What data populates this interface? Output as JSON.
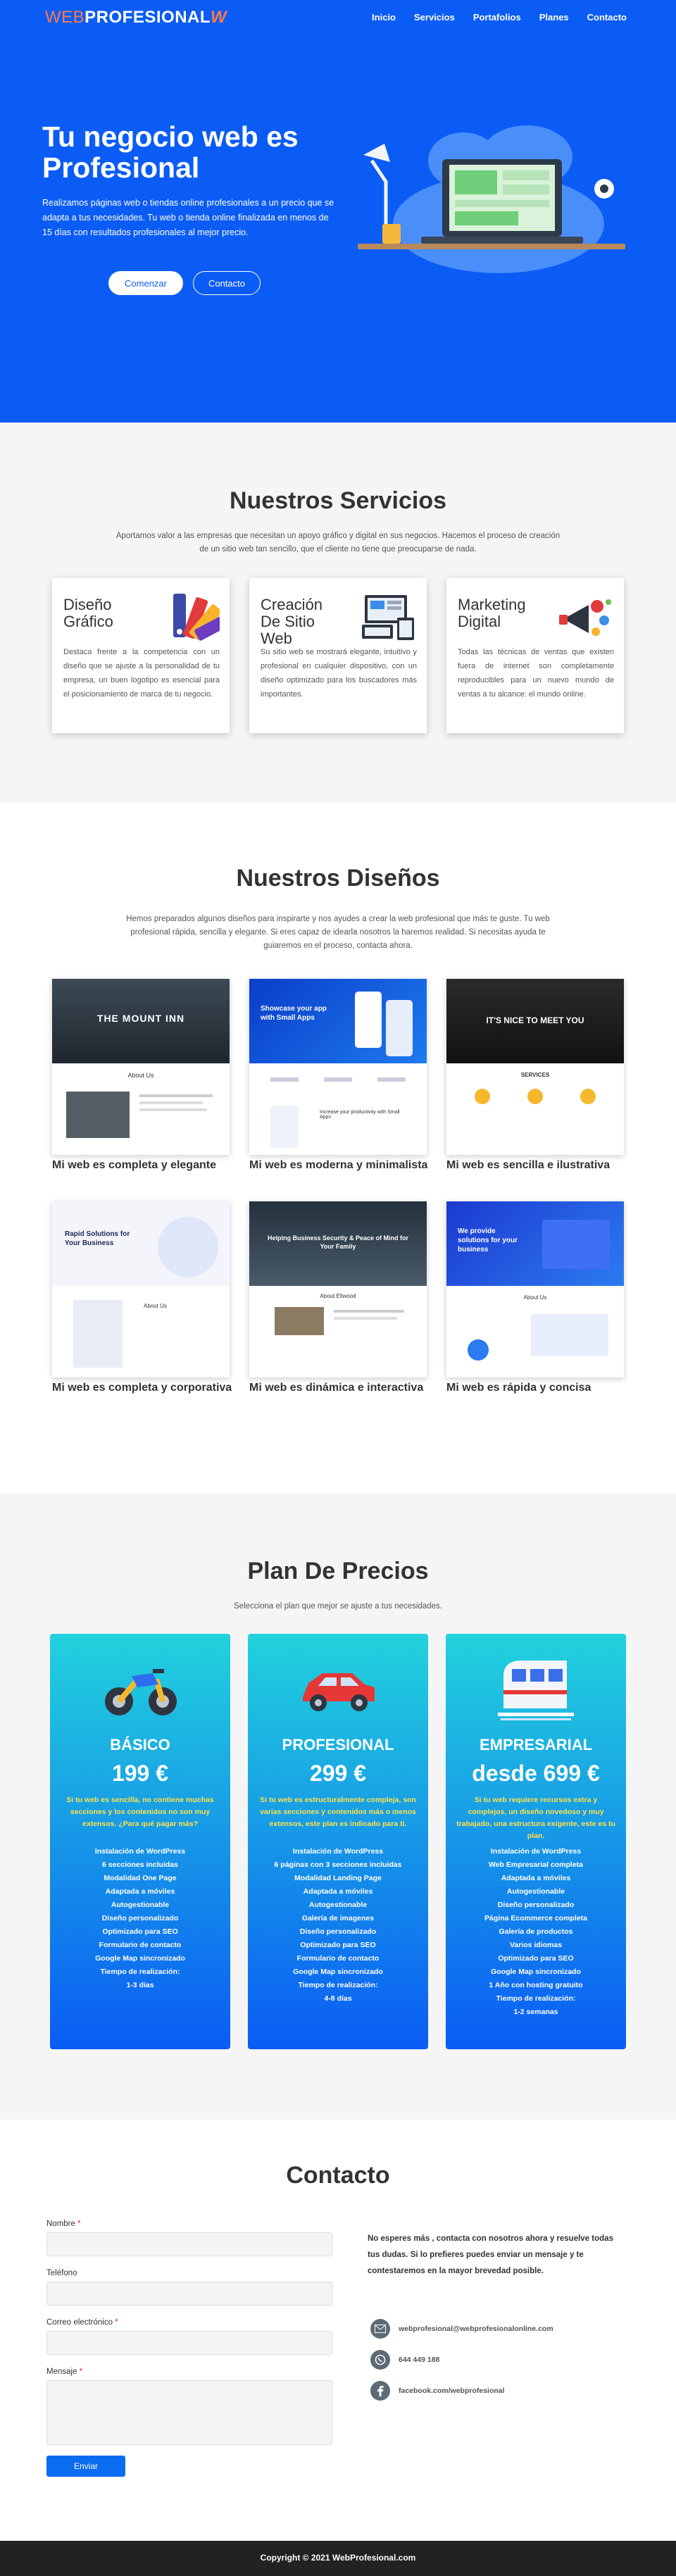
{
  "header": {
    "logo_part1": "WEB",
    "logo_part2": "PROFESIONAL",
    "nav": [
      "Inicio",
      "Servicios",
      "Portafolios",
      "Planes",
      "Contacto"
    ]
  },
  "hero": {
    "title": "Tu negocio web es Profesional",
    "text": "Realizamos páginas web o tiendas online profesionales a un precio que se adapta a tus necesidades. Tu web o tienda online finalizada en menos de 15 días con resultados profesionales al mejor precio.",
    "btn_primary": "Comenzar",
    "btn_secondary": "Contacto"
  },
  "services": {
    "title": "Nuestros Servicios",
    "subtitle": "Aportamos valor a las empresas que necesitan un apoyo gráfico y digital en sus negocios. Hacemos el proceso de creación de un sitio web tan sencillo, que el cliente no tiene que preocuparse de nada.",
    "cards": [
      {
        "title": "Diseño Gráfico",
        "text": "Destaca frente a la competencia con un diseño que se ajuste a la personalidad de tu empresa, un buen logotipo es esencial para el posicionamiento de marca de tu negocio.",
        "icon": "color-palette-icon"
      },
      {
        "title": "Creación De Sitio Web",
        "text": "Su sitio web se mostrará elegante, intuitivo y profesional en cualquier dispositivo, con un diseño optimizado para los buscadores más importantes.",
        "icon": "devices-icon"
      },
      {
        "title": "Marketing Digital",
        "text": "Todas las técnicas de ventas que existen fuera de internet son completamente reproducibles para un nuevo mundo de ventas a tu alcance: el mundo online.",
        "icon": "megaphone-icon"
      }
    ]
  },
  "designs": {
    "title": "Nuestros Diseños",
    "subtitle": "Hemos preparados algunos diseños para inspirarte y nos ayudes a crear la web profesional que más te guste. Tu web profesional rápida, sencilla y elegante. Si eres capaz de idearla nosotros la haremos realidad. Si necesitas ayuda te guiaremos en el proceso, contacta ahora.",
    "items": [
      {
        "caption": "Mi web es completa y elegante",
        "thumb_heading": "THE MOUNT INN",
        "thumb_sub": "About Us"
      },
      {
        "caption": "Mi web es moderna y minimalista",
        "thumb_heading": "Showcase your app with Small Apps",
        "thumb_sub": "Increase your productivity with Small Apps"
      },
      {
        "caption": "Mi web es sencilla e ilustrativa",
        "thumb_heading": "IT'S NICE TO MEET YOU",
        "thumb_sub": "SERVICES"
      },
      {
        "caption": "Mi web es completa y corporativa",
        "thumb_heading": "Rapid Solutions for Your Business",
        "thumb_sub": "About Us"
      },
      {
        "caption": "Mi web es dinámica e interactiva",
        "thumb_heading": "Helping Business Security & Peace of Mind for Your Family",
        "thumb_sub": "About Ellwood"
      },
      {
        "caption": "Mi web es rápida y concisa",
        "thumb_heading": "We provide solutions for your business",
        "thumb_sub": "About Us"
      }
    ]
  },
  "pricing": {
    "title": "Plan De Precios",
    "subtitle": "Selecciona el plan que mejor se ajuste a tus necesidades.",
    "plans": [
      {
        "name": "BÁSICO",
        "price": "199 €",
        "icon": "motorcycle-icon",
        "desc": "Si tu web es sencilla, no contiene muchas secciones y los contenidos no son muy extensos. ¿Para qué pagar más?",
        "features": [
          "Instalación de WordPress",
          "6 secciones incluidas",
          "Modalidad One Page",
          "Adaptada a móviles",
          "Autogestionable",
          "Diseño personalizado",
          "Optimizado para SEO",
          "Formulario de contacto",
          "Google Map sincronizado",
          "Tiempo de realización:",
          "1-3 días"
        ]
      },
      {
        "name": "PROFESIONAL",
        "price": "299 €",
        "icon": "car-icon",
        "desc": "Si tu web es estructuralmente compleja, son varias secciones y contenidos más o menos extensos, este plan es indicado para ti.",
        "features": [
          "Instalación de WordPress",
          "6 páginas con 3 secciones incluidas",
          "Modalidad Landing Page",
          "Adaptada a móviles",
          "Autogestionable",
          "Galería de imagenes",
          "Diseño personalizado",
          "Optimizado para SEO",
          "Formulario de contacto",
          "Google Map sincronizado",
          "Tiempo de realización:",
          "4-8 días"
        ]
      },
      {
        "name": "EMPRESARIAL",
        "price": "desde 699 €",
        "icon": "train-icon",
        "desc": "Si tu web requiere recursos extra y complejos, un diseño novedoso y muy trabajado, una estructura exigente, este es tu plan.",
        "features": [
          "Instalación de WordPress",
          "Web Empresarial completa",
          "Adaptada a móviles",
          "Autogestionable",
          "Diseño personalizado",
          "Página Ecommerce completa",
          "Galería de productos",
          "Varios idiomas",
          "Optimizado para SEO",
          "Google Map sincronizado",
          "1 Año con hosting gratuito",
          "Tiempo de realización:",
          "1-2 semanas"
        ]
      }
    ]
  },
  "contact": {
    "title": "Contacto",
    "fields": {
      "name_label": "Nombre",
      "phone_label": "Teléfono",
      "email_label": "Correo electrónico",
      "message_label": "Mensaje",
      "required_mark": "*"
    },
    "send": "Enviar",
    "text": "No esperes más , contacta con nosotros ahora y resuelve todas tus dudas. Si lo prefieres puedes enviar un mensaje y te contestaremos en la mayor brevedad posible.",
    "email": "webprofesional@webprofesionalonline.com",
    "phone": "644 449 188",
    "facebook": "facebook.com/webprofesional"
  },
  "footer": {
    "text": "Copyright © 2021 WebProfesional.com"
  },
  "colors": {
    "brand_blue": "#0a5cf5",
    "accent_orange": "#ff7a45",
    "highlight_yellow": "#ffe14a",
    "footer_dark": "#222222"
  }
}
